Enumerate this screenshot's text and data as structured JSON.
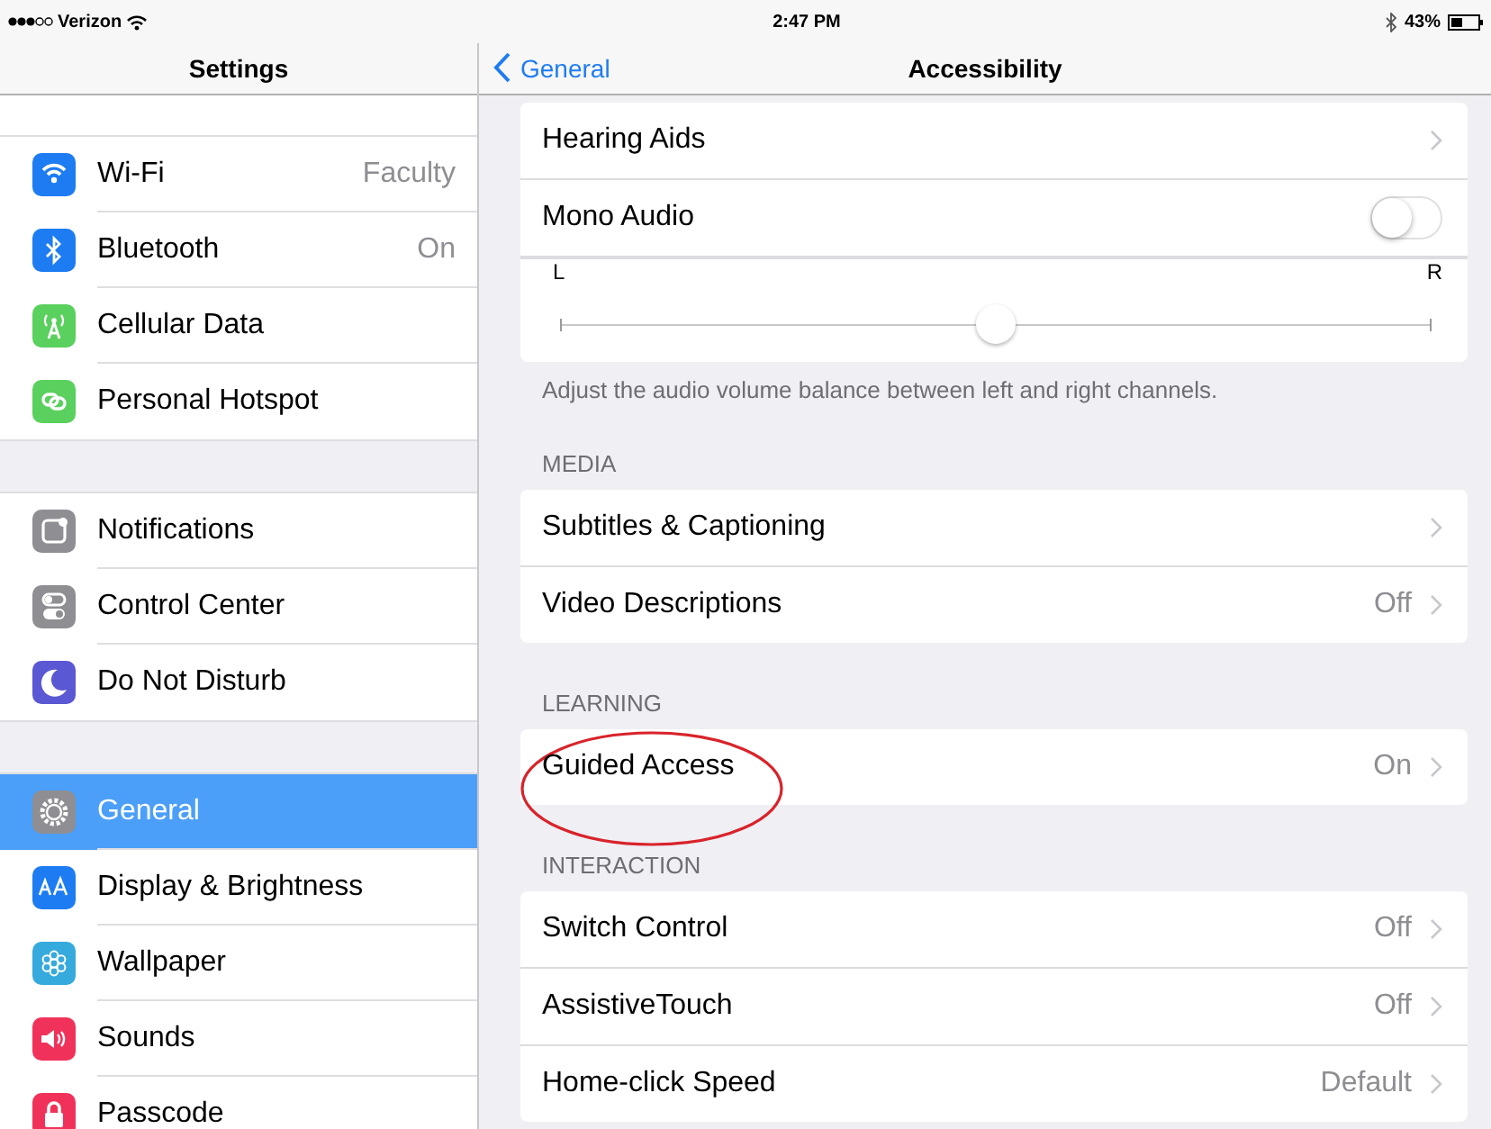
{
  "status_bar": {
    "carrier": "Verizon",
    "time": "2:47 PM",
    "battery": "43%"
  },
  "sidebar": {
    "title": "Settings",
    "groups": [
      [
        {
          "label": "Wi-Fi",
          "value": "Faculty",
          "kind": "wifi",
          "color": "#1e7cf2",
          "selected": false
        },
        {
          "label": "Bluetooth",
          "value": "On",
          "kind": "bluetooth",
          "color": "#1e7cf2",
          "selected": false
        },
        {
          "label": "Cellular Data",
          "kind": "antenna",
          "color": "#5ad05e",
          "selected": false
        },
        {
          "label": "Personal Hotspot",
          "kind": "link",
          "color": "#5ad05e",
          "selected": false
        }
      ],
      [
        {
          "label": "Notifications",
          "kind": "notifications",
          "color": "#8e8e93",
          "selected": false
        },
        {
          "label": "Control Center",
          "kind": "switches",
          "color": "#8e8e93",
          "selected": false
        },
        {
          "label": "Do Not Disturb",
          "kind": "moon",
          "color": "#5a58d2",
          "selected": false
        }
      ],
      [
        {
          "label": "General",
          "kind": "gear",
          "color": "#8e8e93",
          "selected": true
        },
        {
          "label": "Display & Brightness",
          "kind": "text",
          "color": "#1e7cf2",
          "selected": false
        },
        {
          "label": "Wallpaper",
          "kind": "flower",
          "color": "#36aadc",
          "selected": false
        },
        {
          "label": "Sounds",
          "kind": "speaker",
          "color": "#f0325a",
          "selected": false
        },
        {
          "label": "Passcode",
          "kind": "lock",
          "color": "#f0325a",
          "selected": false
        }
      ]
    ]
  },
  "detail": {
    "back": "General",
    "title": "Accessibility",
    "sections": [
      {
        "rows": [
          {
            "kind": "link",
            "label": "Hearing Aids"
          },
          {
            "kind": "toggle",
            "label": "Mono Audio",
            "on": false
          },
          {
            "kind": "balance",
            "left": "L",
            "right": "R",
            "level": 0.5
          }
        ],
        "footer": "Adjust the audio volume balance between left and right channels."
      },
      {
        "header": "MEDIA",
        "rows": [
          {
            "kind": "link",
            "label": "Subtitles & Captioning"
          },
          {
            "kind": "link",
            "label": "Video Descriptions",
            "value": "Off"
          }
        ]
      },
      {
        "header": "LEARNING",
        "rows": [
          {
            "kind": "link",
            "label": "Guided Access",
            "value": "On",
            "circled": true
          }
        ]
      },
      {
        "header": "INTERACTION",
        "rows": [
          {
            "kind": "link",
            "label": "Switch Control",
            "value": "Off"
          },
          {
            "kind": "link",
            "label": "AssistiveTouch",
            "value": "Off"
          },
          {
            "kind": "link",
            "label": "Home-click Speed",
            "value": "Default"
          }
        ]
      }
    ]
  }
}
